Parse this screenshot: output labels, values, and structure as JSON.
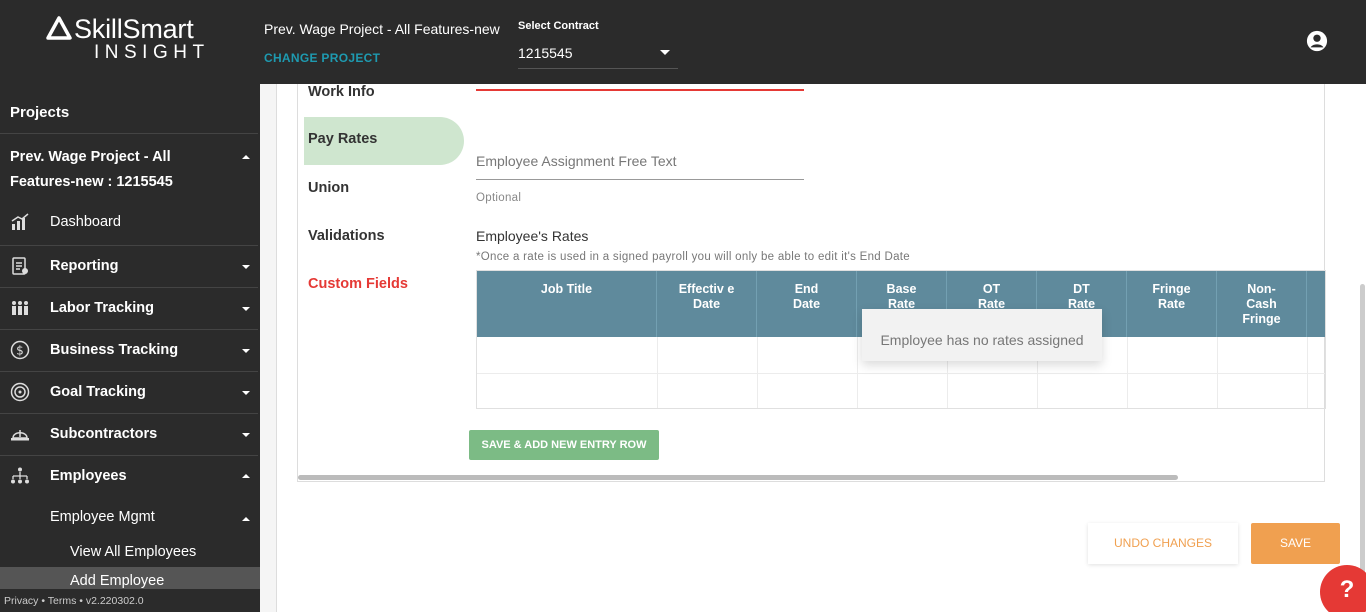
{
  "brand": {
    "name": "SkillSmart",
    "sub": "INSIGHT"
  },
  "header": {
    "project_title": "Prev. Wage Project - All Features-new",
    "change_project": "CHANGE PROJECT",
    "contract_label": "Select Contract",
    "contract_value": "1215545"
  },
  "sidebar": {
    "projects_label": "Projects",
    "project_name": "Prev. Wage Project - All Features-new : 1215545",
    "items": [
      {
        "label": "Dashboard",
        "icon": "dashboard-icon"
      },
      {
        "label": "Reporting",
        "icon": "reporting-icon"
      },
      {
        "label": "Labor Tracking",
        "icon": "labor-icon"
      },
      {
        "label": "Business Tracking",
        "icon": "dollar-icon"
      },
      {
        "label": "Goal Tracking",
        "icon": "target-icon"
      },
      {
        "label": "Subcontractors",
        "icon": "hardhat-icon"
      },
      {
        "label": "Employees",
        "icon": "org-chart-icon"
      }
    ],
    "employee_mgmt": "Employee Mgmt",
    "view_all": "View All Employees",
    "add_employee": "Add Employee",
    "footer": "Privacy • Terms • v2.220302.0"
  },
  "tabs": {
    "work_info": "Work Info",
    "pay_rates": "Pay Rates",
    "union": "Union",
    "validations": "Validations",
    "custom_fields": "Custom Fields"
  },
  "form": {
    "free_text_placeholder": "Employee Assignment Free Text",
    "optional": "Optional",
    "rates_title": "Employee's Rates",
    "rates_note": "*Once a rate is used in a signed payroll you will only be able to edit it's End Date"
  },
  "table": {
    "headers": [
      "Job Title",
      "Effectiv e Date",
      "End Date",
      "Base Rate",
      "OT Rate",
      "DT Rate",
      "Fringe Rate",
      "Non-Cash Fringe"
    ],
    "empty_message": "Employee has no rates assigned"
  },
  "buttons": {
    "save_add_row": "SAVE & ADD NEW ENTRY ROW",
    "undo": "UNDO CHANGES",
    "save": "SAVE",
    "help": "?"
  },
  "colors": {
    "topbar": "#2b2b2b",
    "accent_teal": "#1e9ab0",
    "active_green": "#3f8a3f",
    "table_header": "#5f8a9c",
    "orange": "#f0a050",
    "red": "#e53935"
  }
}
